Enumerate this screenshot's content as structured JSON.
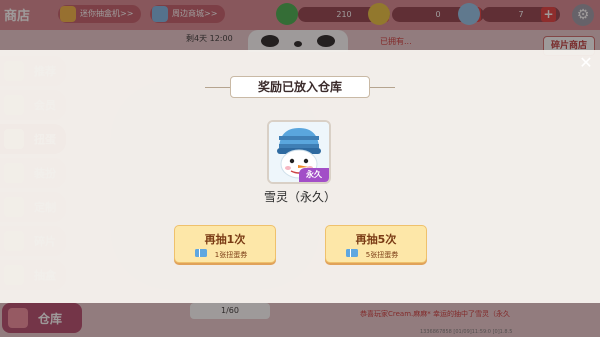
{
  "top_bar": {
    "shop_title": "商店",
    "chip_mini_jukebox": "迷你抽盒机>>",
    "chip_merch": "周边商城>>",
    "gem_count": "210",
    "coin_count": "0",
    "ticket_count": "7"
  },
  "sidebar": {
    "items": [
      {
        "label": "推荐"
      },
      {
        "label": "会员"
      },
      {
        "label": "扭蛋"
      },
      {
        "label": "装扮"
      },
      {
        "label": "定制"
      },
      {
        "label": "碎片"
      },
      {
        "label": "抽盒"
      }
    ],
    "warehouse_label": "仓库"
  },
  "background": {
    "timer": "剩4天 12:00",
    "owned": "已拥有...",
    "fragment_shop": "碎片商店",
    "ticket_progress": "1/60",
    "broadcast": "恭喜玩家Cream.麻麻* 幸运的抽中了雪灵（永久",
    "build_info": "1336867858 [01/09]11:59:0 [0]1.8.5"
  },
  "modal": {
    "banner": "奖励已放入仓库",
    "item_name": "雪灵（永久）",
    "item_tag": "永久",
    "buttons": [
      {
        "label": "再抽1次",
        "cost": "1张扭蛋券"
      },
      {
        "label": "再抽5次",
        "cost": "5张扭蛋券"
      }
    ]
  },
  "colors": {
    "permanent_tag": "#a24ec7",
    "draw_button": "#fde7a8",
    "accent_red": "#d8626e"
  }
}
